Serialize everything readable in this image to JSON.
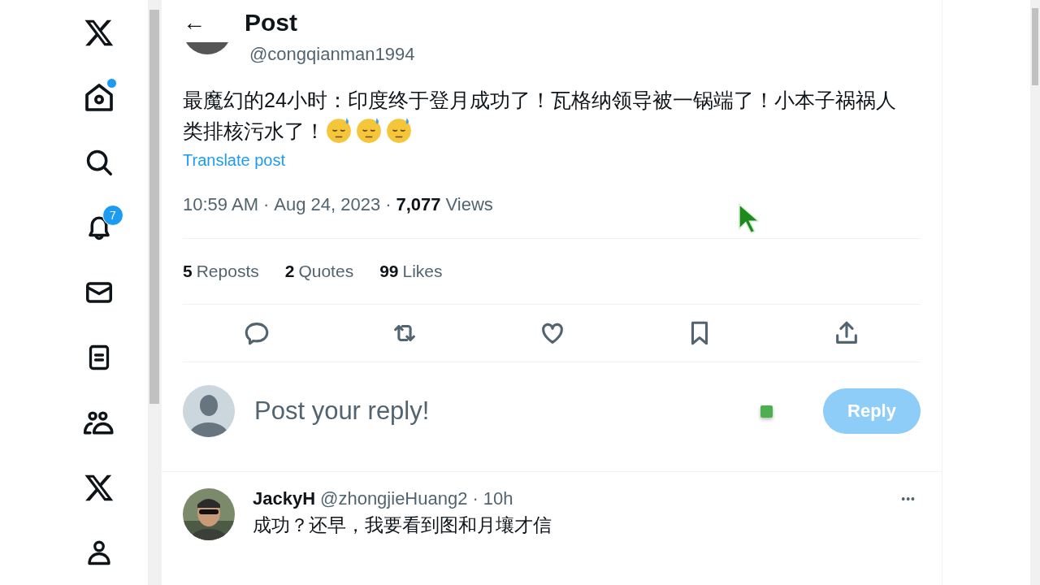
{
  "nav": [
    {
      "kind": "logo"
    },
    {
      "kind": "home",
      "dot": true
    },
    {
      "kind": "search"
    },
    {
      "kind": "bell",
      "badge": "7"
    },
    {
      "kind": "mail"
    },
    {
      "kind": "lists"
    },
    {
      "kind": "communities"
    },
    {
      "kind": "premium"
    },
    {
      "kind": "profile"
    }
  ],
  "header": {
    "back": "←",
    "title": "Post"
  },
  "post": {
    "handle": "@congqianman1994",
    "text": "最魔幻的24小时：印度终于登月成功了！瓦格纳领导被一锅端了！小本子祸祸人类排核污水了！",
    "emojis": [
      {
        "kind": "sweat"
      },
      {
        "kind": "sweat"
      },
      {
        "kind": "sweat"
      }
    ],
    "translate": "Translate post",
    "time": "10:59 AM",
    "sep1": "·",
    "date": "Aug 24, 2023",
    "sep2": "·",
    "views_count": "7,077",
    "views_label": "Views",
    "stats": [
      {
        "count": "5",
        "label": "Reposts"
      },
      {
        "count": "2",
        "label": "Quotes"
      },
      {
        "count": "99",
        "label": "Likes"
      }
    ],
    "actions": [
      {
        "kind": "reply"
      },
      {
        "kind": "repost"
      },
      {
        "kind": "like"
      },
      {
        "kind": "bookmark"
      },
      {
        "kind": "share"
      }
    ]
  },
  "composer": {
    "placeholder": "Post your reply!",
    "button": "Reply",
    "disabled": true
  },
  "replies": [
    {
      "name": "JackyH",
      "handle": "@zhongjieHuang2",
      "sep": "·",
      "age": "10h",
      "text": "成功？还早，我要看到图和月壤才信",
      "more": "•••"
    }
  ]
}
